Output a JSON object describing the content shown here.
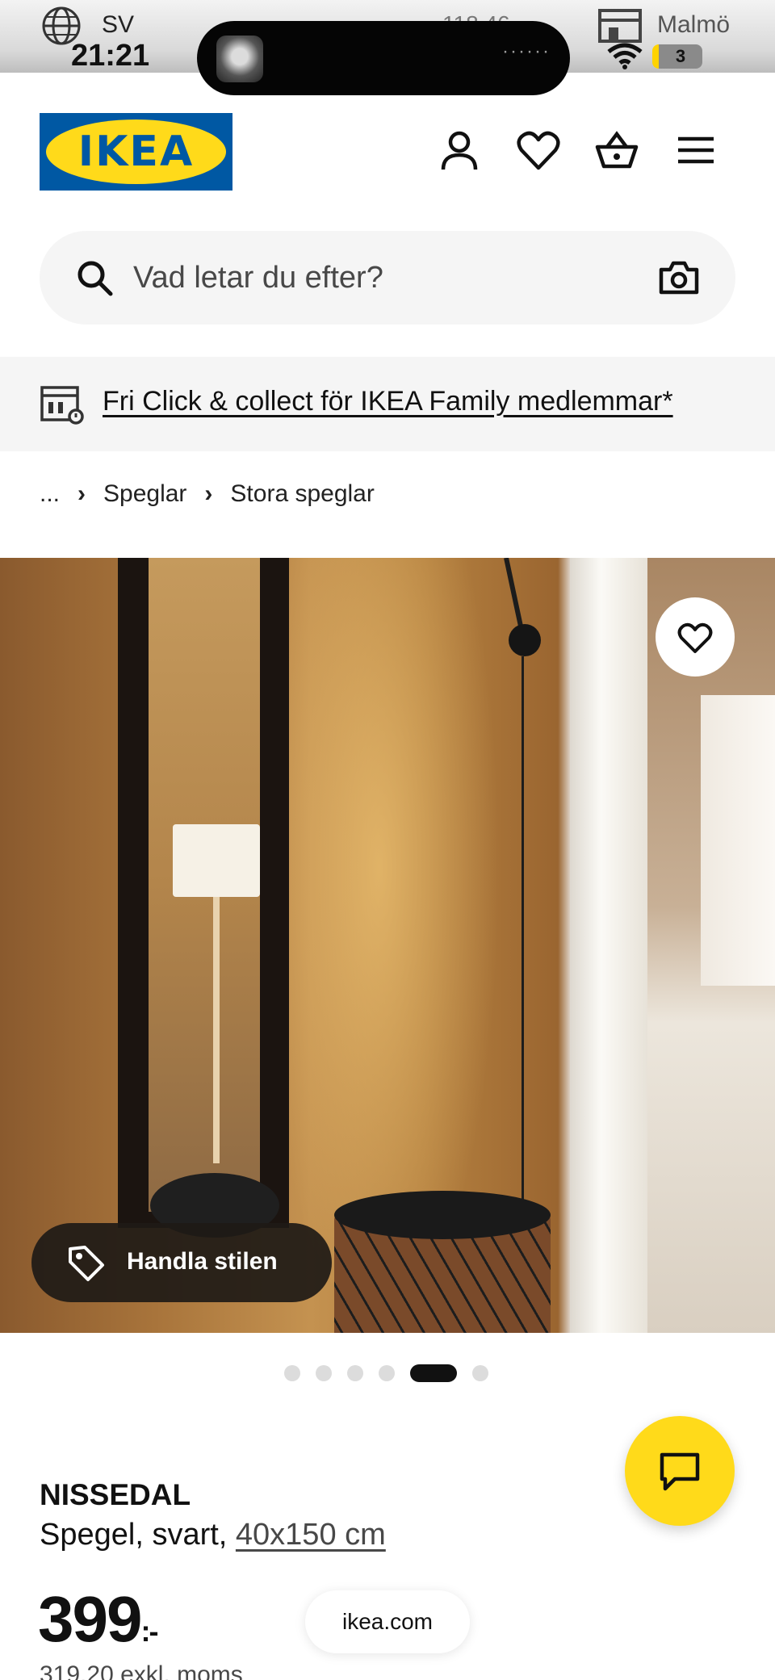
{
  "status_bar": {
    "language": "SV",
    "time": "21:21",
    "network": "118.46",
    "store": "Malmö",
    "battery": "3"
  },
  "header": {
    "logo": "IKEA",
    "icons": [
      "user-icon",
      "heart-icon",
      "basket-icon",
      "menu-icon"
    ]
  },
  "search": {
    "placeholder": "Vad letar du efter?"
  },
  "banner": {
    "text": "Fri Click & collect för IKEA Family medlemmar*"
  },
  "breadcrumb": {
    "items": [
      "...",
      "Speglar",
      "Stora speglar"
    ]
  },
  "gallery": {
    "shop_style_label": "Handla stilen",
    "dot_count": 6,
    "active_index": 4
  },
  "product": {
    "name": "NISSEDAL",
    "description": "Spegel, svart,",
    "size": "40x150 cm",
    "price": "399",
    "price_suffix": ":-",
    "price_excl": "319,20 exkl. moms"
  },
  "browser": {
    "domain": "ikea.com"
  },
  "colors": {
    "ikea_blue": "#0058a3",
    "ikea_yellow": "#ffda1a"
  }
}
